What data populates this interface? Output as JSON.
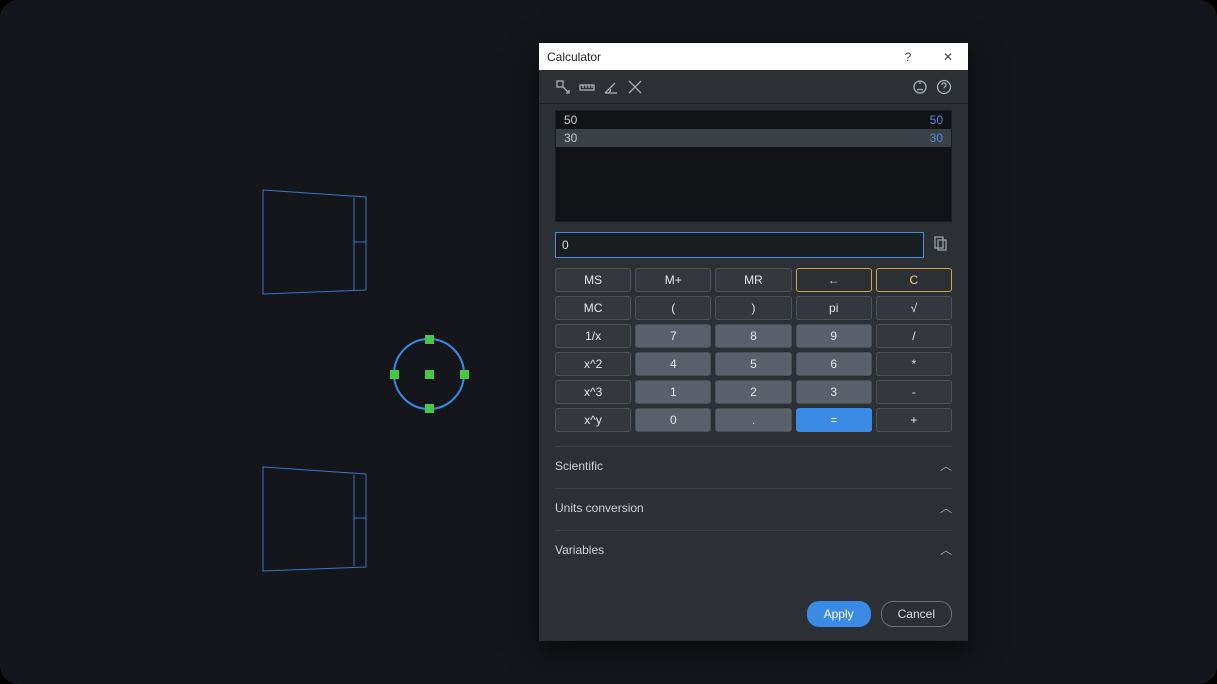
{
  "window": {
    "title": "Calculator",
    "help_glyph": "?",
    "close_glyph": "✕"
  },
  "history": [
    {
      "expr": "50",
      "result": "50",
      "selected": false
    },
    {
      "expr": "30",
      "result": "30",
      "selected": true
    }
  ],
  "input": {
    "value": "0"
  },
  "buttons": {
    "r1": [
      "MS",
      "M+",
      "MR",
      "←",
      "C"
    ],
    "r2": [
      "MC",
      "(",
      ")",
      "pi",
      "√"
    ],
    "r3": [
      "1/x",
      "7",
      "8",
      "9",
      "/"
    ],
    "r4": [
      "x^2",
      "4",
      "5",
      "6",
      "*"
    ],
    "r5": [
      "x^3",
      "1",
      "2",
      "3",
      "-"
    ],
    "r6": [
      "x^y",
      "0",
      ".",
      "=",
      "+"
    ]
  },
  "sections": {
    "scientific": "Scientific",
    "units": "Units conversion",
    "variables": "Variables"
  },
  "footer": {
    "apply": "Apply",
    "cancel": "Cancel"
  },
  "icons": {
    "tool_transform": "transform-icon",
    "tool_distance": "ruler-icon",
    "tool_angle": "angle-icon",
    "tool_intersect": "intersect-icon",
    "tool_units": "units-icon",
    "tool_help": "help-icon",
    "paste": "paste-icon"
  }
}
